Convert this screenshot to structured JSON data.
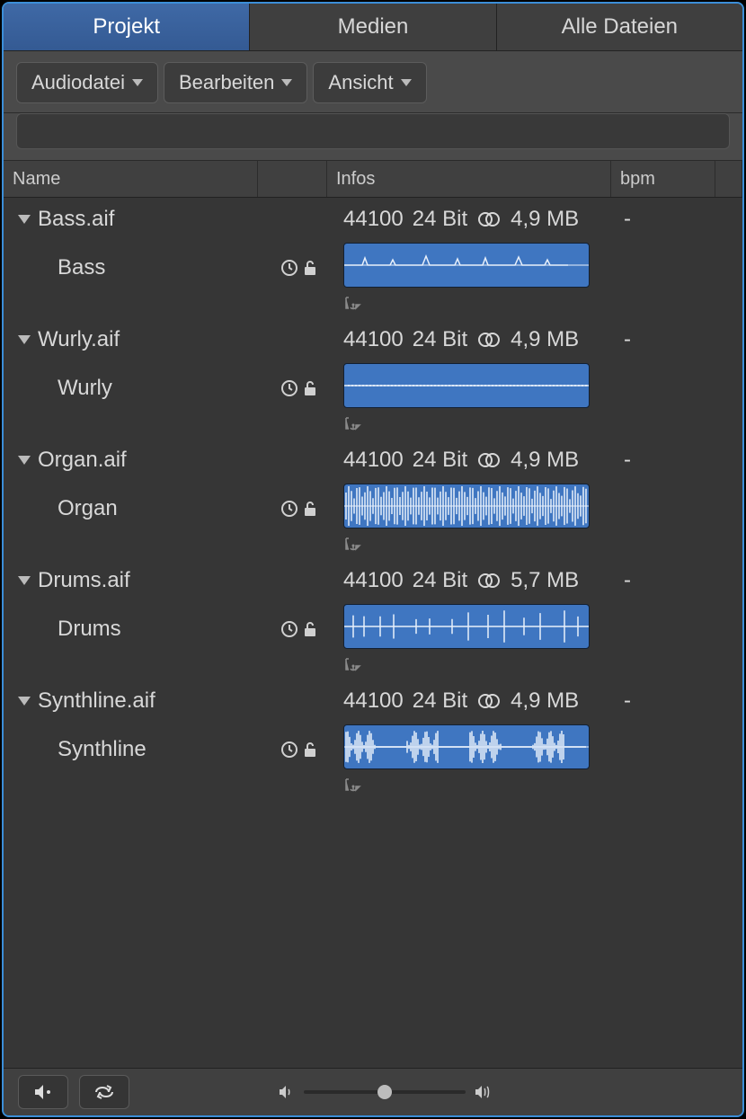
{
  "tabs": {
    "projekt": "Projekt",
    "medien": "Medien",
    "alle": "Alle Dateien"
  },
  "toolbar": {
    "audiodatei": "Audiodatei",
    "bearbeiten": "Bearbeiten",
    "ansicht": "Ansicht"
  },
  "header": {
    "name": "Name",
    "infos": "Infos",
    "bpm": "bpm"
  },
  "files": [
    {
      "filename": "Bass.aif",
      "region": "Bass",
      "rate": "44100",
      "bits": "24 Bit",
      "size": "4,9 MB",
      "bpm": "-"
    },
    {
      "filename": "Wurly.aif",
      "region": "Wurly",
      "rate": "44100",
      "bits": "24 Bit",
      "size": "4,9 MB",
      "bpm": "-"
    },
    {
      "filename": "Organ.aif",
      "region": "Organ",
      "rate": "44100",
      "bits": "24 Bit",
      "size": "4,9 MB",
      "bpm": "-"
    },
    {
      "filename": "Drums.aif",
      "region": "Drums",
      "rate": "44100",
      "bits": "24 Bit",
      "size": "5,7 MB",
      "bpm": "-"
    },
    {
      "filename": "Synthline.aif",
      "region": "Synthline",
      "rate": "44100",
      "bits": "24 Bit",
      "size": "4,9 MB",
      "bpm": "-"
    }
  ],
  "icons": {
    "stereo": "stereo-icon",
    "clock": "clock-icon",
    "lock": "lock-open-icon",
    "anchor": "anchor-icon",
    "speaker": "speaker-icon",
    "loop": "loop-icon",
    "vol_low": "volume-low-icon",
    "vol_high": "volume-high-icon"
  }
}
